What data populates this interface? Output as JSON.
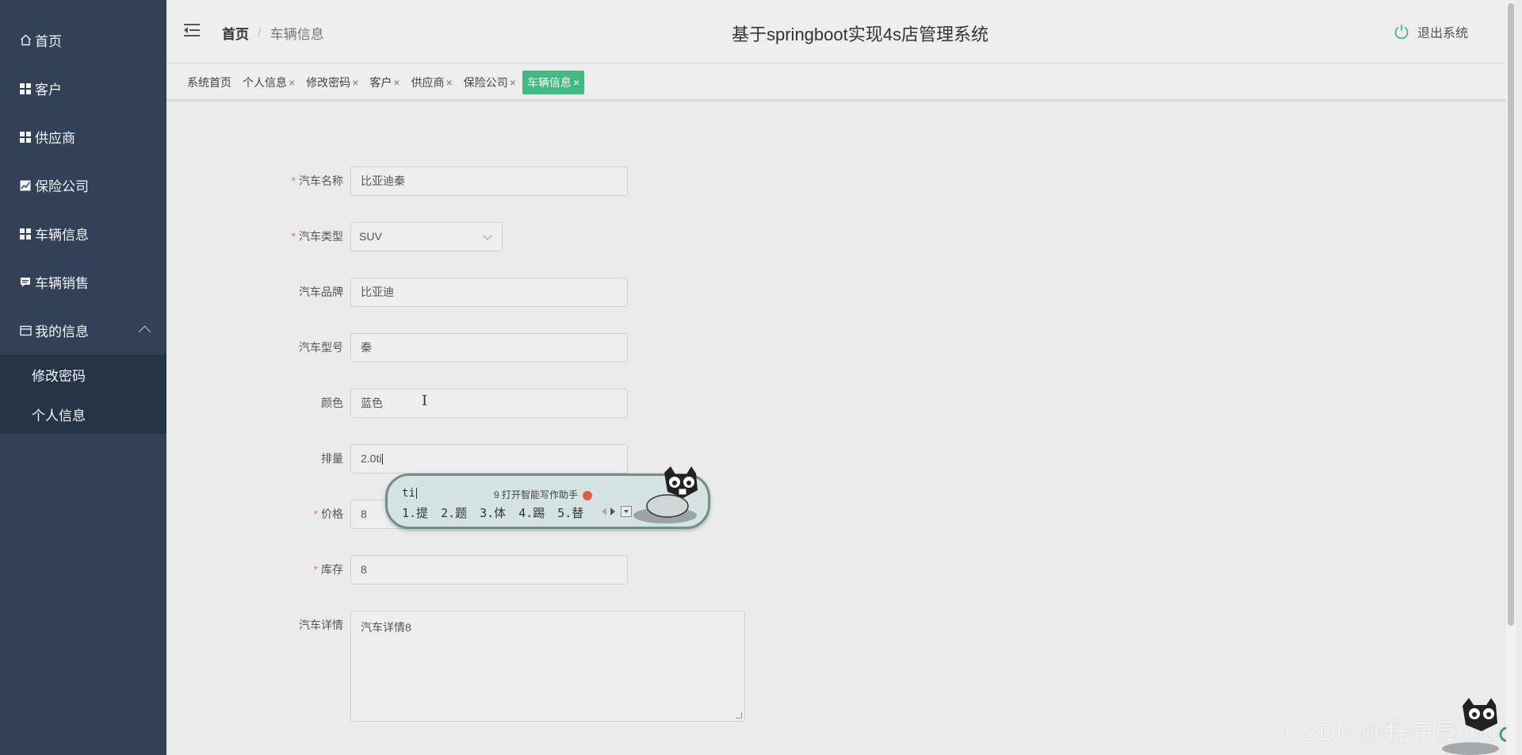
{
  "sidebar": {
    "items": [
      {
        "label": "首页",
        "icon": "home-icon"
      },
      {
        "label": "客户",
        "icon": "grid-icon"
      },
      {
        "label": "供应商",
        "icon": "grid-icon"
      },
      {
        "label": "保险公司",
        "icon": "chart-icon"
      },
      {
        "label": "车辆信息",
        "icon": "grid-icon"
      },
      {
        "label": "车辆销售",
        "icon": "chat-icon"
      },
      {
        "label": "我的信息",
        "icon": "card-icon",
        "expanded": true
      }
    ],
    "subitems": [
      {
        "label": "修改密码"
      },
      {
        "label": "个人信息"
      }
    ]
  },
  "header": {
    "breadcrumb_home": "首页",
    "breadcrumb_separator": "/",
    "breadcrumb_current": "车辆信息",
    "title": "基于springboot实现4s店管理系统",
    "logout_label": "退出系统"
  },
  "tabs": [
    {
      "label": "系统首页",
      "closable": false
    },
    {
      "label": "个人信息",
      "closable": true
    },
    {
      "label": "修改密码",
      "closable": true
    },
    {
      "label": "客户",
      "closable": true
    },
    {
      "label": "供应商",
      "closable": true
    },
    {
      "label": "保险公司",
      "closable": true
    },
    {
      "label": "车辆信息",
      "closable": true,
      "active": true
    }
  ],
  "tab_close_glyph": "×",
  "form": {
    "required_mark": "*",
    "fields": {
      "name": {
        "label": "汽车名称",
        "value": "比亚迪秦",
        "required": true
      },
      "type": {
        "label": "汽车类型",
        "value": "SUV",
        "required": true
      },
      "brand": {
        "label": "汽车品牌",
        "value": "比亚迪"
      },
      "model": {
        "label": "汽车型号",
        "value": "秦"
      },
      "color": {
        "label": "颜色",
        "value": "蓝色"
      },
      "displacement": {
        "label": "排量",
        "value": "2.0ti"
      },
      "price": {
        "label": "价格",
        "value": "8",
        "required": true
      },
      "stock": {
        "label": "库存",
        "value": "8",
        "required": true
      },
      "details": {
        "label": "汽车详情",
        "value": "汽车详情8"
      }
    }
  },
  "ime": {
    "composition": "ti",
    "hint": "9 打开智能写作助手",
    "candidates": [
      "1.提",
      "2.题",
      "3.体",
      "4.踢",
      "5.替"
    ]
  },
  "watermark": "CSDN @程序员code",
  "colors": {
    "sidebar_bg": "#324157",
    "submenu_bg": "#263445",
    "active_tab": "#42b983",
    "required": "#f56c6c"
  }
}
